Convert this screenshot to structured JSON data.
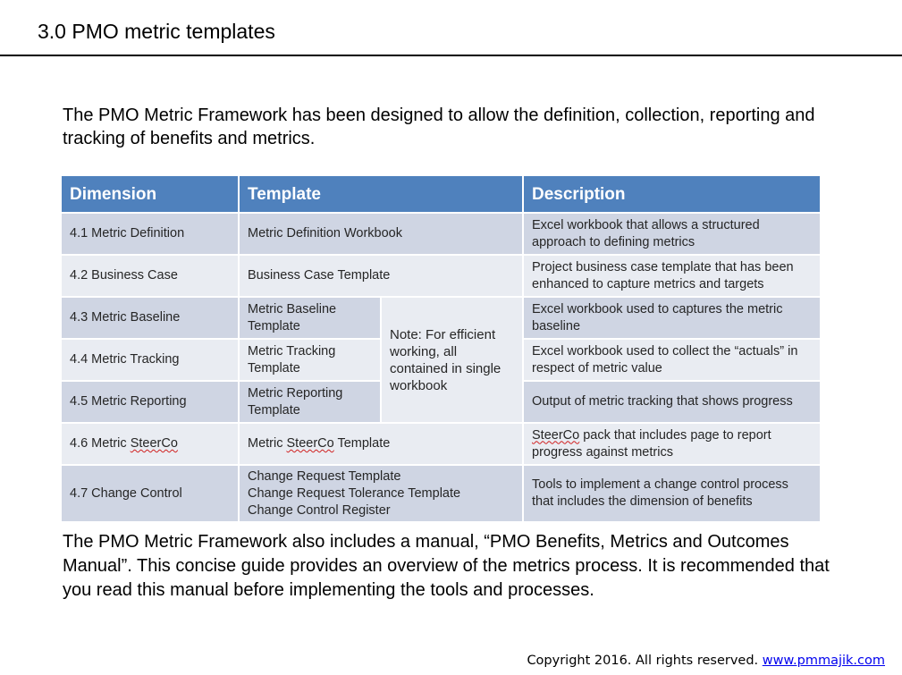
{
  "page": {
    "title": "3.0 PMO metric templates",
    "intro": "The PMO Metric Framework has been designed to allow the definition, collection, reporting and tracking of benefits and metrics.",
    "outro": "The PMO Metric Framework also includes a manual, “PMO Benefits, Metrics and Outcomes Manual”.  This concise guide provides an overview of the metrics process.  It is recommended that you read this manual before implementing the tools and processes."
  },
  "table": {
    "colors": {
      "header": "#4f81bd",
      "row_dark": "#cfd5e3",
      "row_light": "#e9ecf2"
    },
    "headers": [
      "Dimension",
      "Template",
      "Description"
    ],
    "note": "Note: For efficient working, all contained in single workbook",
    "rows": [
      {
        "dimension": "4.1 Metric Definition",
        "template": "Metric Definition Workbook",
        "description": "Excel workbook that allows a structured approach to defining metrics"
      },
      {
        "dimension": "4.2 Business Case",
        "template": "Business Case Template",
        "description": "Project business case template that has been enhanced to capture metrics and targets"
      },
      {
        "dimension": "4.3 Metric Baseline",
        "template": "Metric Baseline Template",
        "description": "Excel workbook used to captures the metric baseline"
      },
      {
        "dimension": "4.4 Metric Tracking",
        "template": "Metric Tracking Template",
        "description": "Excel workbook used to collect the “actuals” in respect of metric value"
      },
      {
        "dimension": "4.5 Metric Reporting",
        "template": "Metric Reporting Template",
        "description": "Output of metric tracking that shows progress"
      },
      {
        "dimension_prefix": "4.6 Metric ",
        "dimension_word": "SteerCo",
        "template_prefix": "Metric ",
        "template_word": "SteerCo",
        "template_suffix": " Template",
        "description_word": "SteerCo",
        "description_suffix": " pack that includes page to report progress against metrics"
      },
      {
        "dimension": "4.7 Change Control",
        "template_lines": [
          "Change Request Template",
          "Change Request Tolerance Template",
          "Change Control Register"
        ],
        "description": "Tools to implement a change control process that includes the dimension of benefits"
      }
    ]
  },
  "footer": {
    "copyright": "Copyright 2016.  All rights reserved. ",
    "link": "www.pmmajik.com"
  }
}
